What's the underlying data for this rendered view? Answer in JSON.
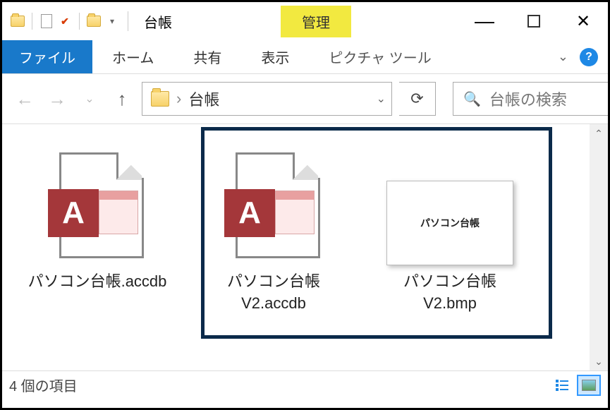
{
  "window": {
    "title": "台帳",
    "contextual_group": "管理",
    "min": "—",
    "max": "▢",
    "close": "✕"
  },
  "ribbon": {
    "file": "ファイル",
    "home": "ホーム",
    "share": "共有",
    "view": "表示",
    "contextual": "ピクチャ ツール",
    "chevron": "⌄",
    "help": "?"
  },
  "nav": {
    "back": "←",
    "forward": "→",
    "dropdown": "⌄",
    "up": "↑",
    "crumb_sep": "›",
    "crumb": "台帳",
    "addr_drop": "⌄",
    "refresh": "⟳",
    "search_placeholder": "台帳の検索"
  },
  "files": [
    {
      "name": "パソコン台帳.accdb",
      "type": "access"
    },
    {
      "name": "パソコン台帳V2.accdb",
      "type": "access"
    },
    {
      "name": "パソコン台帳V2.bmp",
      "type": "bmp",
      "thumb_text": "パソコン台帳"
    }
  ],
  "status": {
    "text": "4 個の項目"
  },
  "scroll": {
    "up": "⌃",
    "down": "⌄"
  }
}
